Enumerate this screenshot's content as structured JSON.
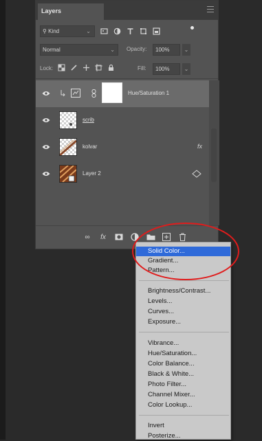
{
  "panel": {
    "tab_title": "Layers",
    "filter": {
      "kind_label": "Kind",
      "icons": [
        "image-filter-icon",
        "adjustment-filter-icon",
        "type-filter-icon",
        "shape-filter-icon",
        "smart-object-filter-icon"
      ]
    },
    "blend_mode": "Normal",
    "opacity_label": "Opacity:",
    "opacity_value": "100%",
    "lock_label": "Lock:",
    "fill_label": "Fill:",
    "fill_value": "100%"
  },
  "layers": [
    {
      "name": "Hue/Saturation 1",
      "type": "adjustment",
      "selected": true
    },
    {
      "name": "scrib",
      "type": "pixel",
      "selected": false
    },
    {
      "name": "kolvar",
      "type": "pixel",
      "effects": "fx",
      "selected": false
    },
    {
      "name": "Layer 2",
      "type": "smart-object",
      "selected": false
    }
  ],
  "footer": {
    "fx_label": "fx"
  },
  "menu": {
    "items": [
      {
        "label": "Solid Color...",
        "highlighted": true
      },
      {
        "label": "Gradient..."
      },
      {
        "label": "Pattern..."
      },
      {
        "label": "Brightness/Contrast..."
      },
      {
        "label": "Levels..."
      },
      {
        "label": "Curves..."
      },
      {
        "label": "Exposure..."
      },
      {
        "label": "Vibrance..."
      },
      {
        "label": "Hue/Saturation..."
      },
      {
        "label": "Color Balance..."
      },
      {
        "label": "Black & White..."
      },
      {
        "label": "Photo Filter..."
      },
      {
        "label": "Channel Mixer..."
      },
      {
        "label": "Color Lookup..."
      },
      {
        "label": "Invert"
      },
      {
        "label": "Posterize..."
      }
    ]
  },
  "colors": {
    "highlight": "#2f6ad9",
    "annotation": "#e01c1c",
    "panel_bg": "#535353"
  }
}
